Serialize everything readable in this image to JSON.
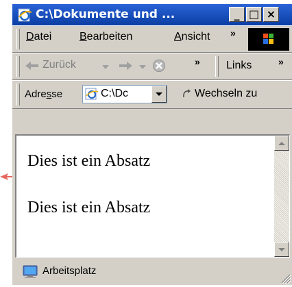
{
  "window": {
    "title": "C:\\Dokumente und ..."
  },
  "title_buttons": {
    "minimize": "_",
    "maximize": "□",
    "close": "×"
  },
  "menu": {
    "items": [
      {
        "label": "Datei",
        "accel": "D",
        "rest": "atei"
      },
      {
        "label": "Bearbeiten",
        "accel": "B",
        "rest": "earbeiten"
      },
      {
        "label": "Ansicht",
        "accel": "A",
        "rest": "nsicht"
      }
    ],
    "more": "»"
  },
  "nav": {
    "back_label": "Zurück",
    "more": "»",
    "links_label": "Links",
    "links_more": "»"
  },
  "address": {
    "label_before": "Adre",
    "label_accel": "s",
    "label_after": "se",
    "value": "C:\\Dc",
    "go_label": "Wechseln zu"
  },
  "content": {
    "paragraphs": [
      "Dies ist ein Absatz",
      "Dies ist ein Absatz"
    ]
  },
  "status": {
    "text": "Arbeitsplatz"
  },
  "colors": {
    "titlebar": "#0b3ea3",
    "chrome": "#d4d0c8",
    "pointer": "#e8685f"
  }
}
